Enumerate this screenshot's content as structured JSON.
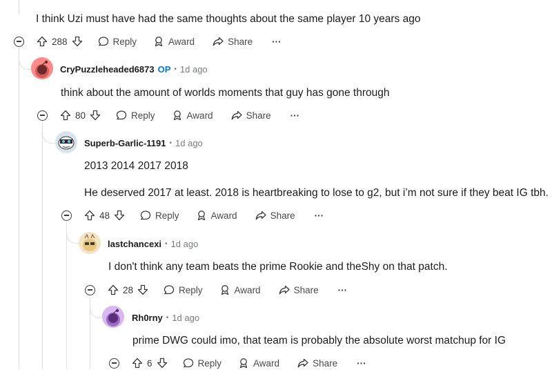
{
  "comments": [
    {
      "text": "I think Uzi must have had the same thoughts about the same player 10 years ago",
      "votes": "288"
    },
    {
      "username": "CryPuzzleheaded6873",
      "op_badge": "OP",
      "time": "1d ago",
      "text": "think about the amount of worlds moments that guy has gone through",
      "votes": "80",
      "avatar_color": "#ff8a8a"
    },
    {
      "username": "Superb-Garlic-1191",
      "time": "1d ago",
      "text": "2013 2014 2017 2018",
      "text2": "He deserved 2017 at least. 2018 is heartbreaking to lose to g2, but i’m not sure if they beat IG tbh.",
      "votes": "48",
      "avatar_color": "#d7e4ee"
    },
    {
      "username": "lastchancexi",
      "time": "1d ago",
      "text": "I don't think any team beats the prime Rookie and theShy on that patch.",
      "votes": "28",
      "avatar_color": "#f3e2c4"
    },
    {
      "username": "Rh0rny",
      "time": "1d ago",
      "text": "prime DWG could imo, that team is probably the absolute worst matchup for IG",
      "votes": "6",
      "avatar_color": "#d9b8f0"
    }
  ],
  "actions": {
    "reply": "Reply",
    "award": "Award",
    "share": "Share",
    "more": "···"
  }
}
